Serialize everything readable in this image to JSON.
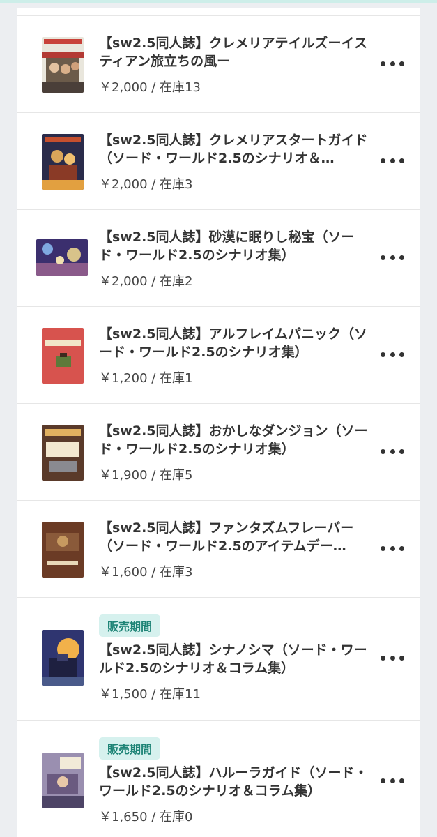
{
  "products": [
    {
      "title": "【sw2.5同人誌】クレメリアテイルズーイスティアン旅立ちの風ー",
      "price": "￥2,000 / 在庫13",
      "badge": "",
      "cover": "cover-book-1"
    },
    {
      "title": "【sw2.5同人誌】クレメリアスタートガイド（ソード・ワールド2.5のシナリオ＆…",
      "price": "￥2,000 / 在庫3",
      "badge": "",
      "cover": "cover-book-2"
    },
    {
      "title": "【sw2.5同人誌】砂漠に眠りし秘宝（ソード・ワールド2.5のシナリオ集）",
      "price": "￥2,000 / 在庫2",
      "badge": "",
      "cover": "cover-book-3"
    },
    {
      "title": "【sw2.5同人誌】アルフレイムパニック（ソード・ワールド2.5のシナリオ集）",
      "price": "￥1,200 / 在庫1",
      "badge": "",
      "cover": "cover-book-4"
    },
    {
      "title": "【sw2.5同人誌】おかしなダンジョン（ソード・ワールド2.5のシナリオ集）",
      "price": "￥1,900 / 在庫5",
      "badge": "",
      "cover": "cover-book-5"
    },
    {
      "title": "【sw2.5同人誌】ファンタズムフレーバー（ソード・ワールド2.5のアイテムデー…",
      "price": "￥1,600 / 在庫3",
      "badge": "",
      "cover": "cover-book-6"
    },
    {
      "title": "【sw2.5同人誌】シナノシマ（ソード・ワールド2.5のシナリオ＆コラム集）",
      "price": "￥1,500 / 在庫11",
      "badge": "販売期間",
      "cover": "cover-book-7"
    },
    {
      "title": "【sw2.5同人誌】ハルーラガイド（ソード・ワールド2.5のシナリオ＆コラム集）",
      "price": "￥1,650 / 在庫0",
      "badge": "販売期間",
      "cover": "cover-book-8"
    }
  ],
  "more_icon": "more-horizontal-icon",
  "colors": {
    "badge_bg": "#d6f1ee",
    "badge_text": "#1e8476",
    "top_accent": "#cdeee9"
  }
}
